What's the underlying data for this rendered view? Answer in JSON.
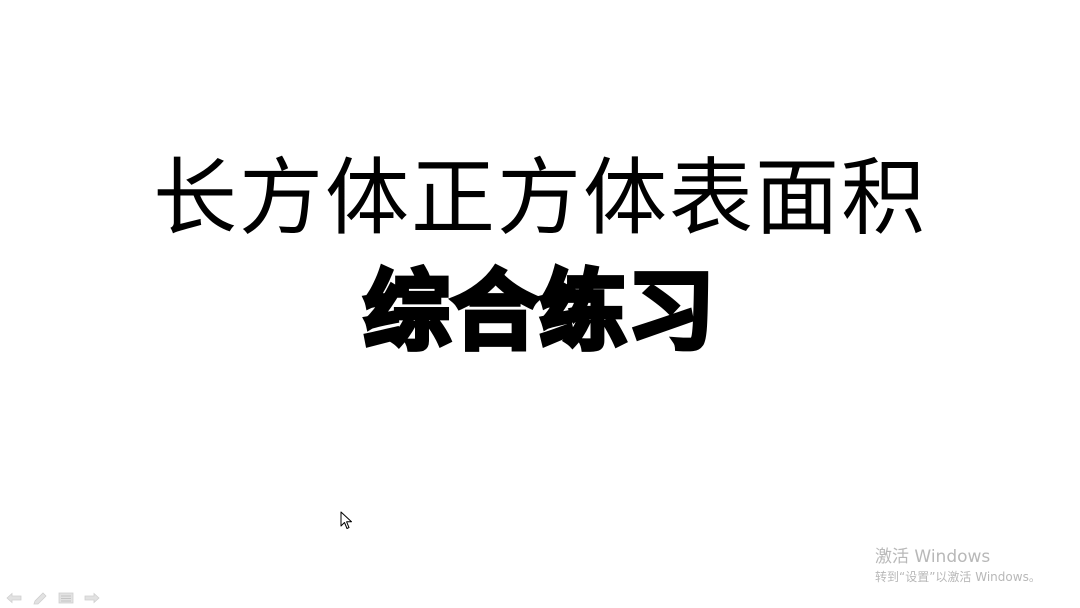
{
  "slide": {
    "title": "长方体正方体表面积",
    "subtitle": "综合练习"
  },
  "watermark": {
    "title": "激活 Windows",
    "subtitle": "转到“设置”以激活 Windows。"
  },
  "navigation": {
    "buttons": [
      {
        "name": "previous",
        "icon": "arrow-left-icon"
      },
      {
        "name": "pen",
        "icon": "pen-icon"
      },
      {
        "name": "menu",
        "icon": "slides-menu-icon"
      },
      {
        "name": "next",
        "icon": "arrow-right-icon"
      }
    ]
  },
  "colors": {
    "background": "#ffffff",
    "text": "#000000",
    "watermark": "#b8b8b8",
    "nav_icons": "#d8d8d8"
  }
}
